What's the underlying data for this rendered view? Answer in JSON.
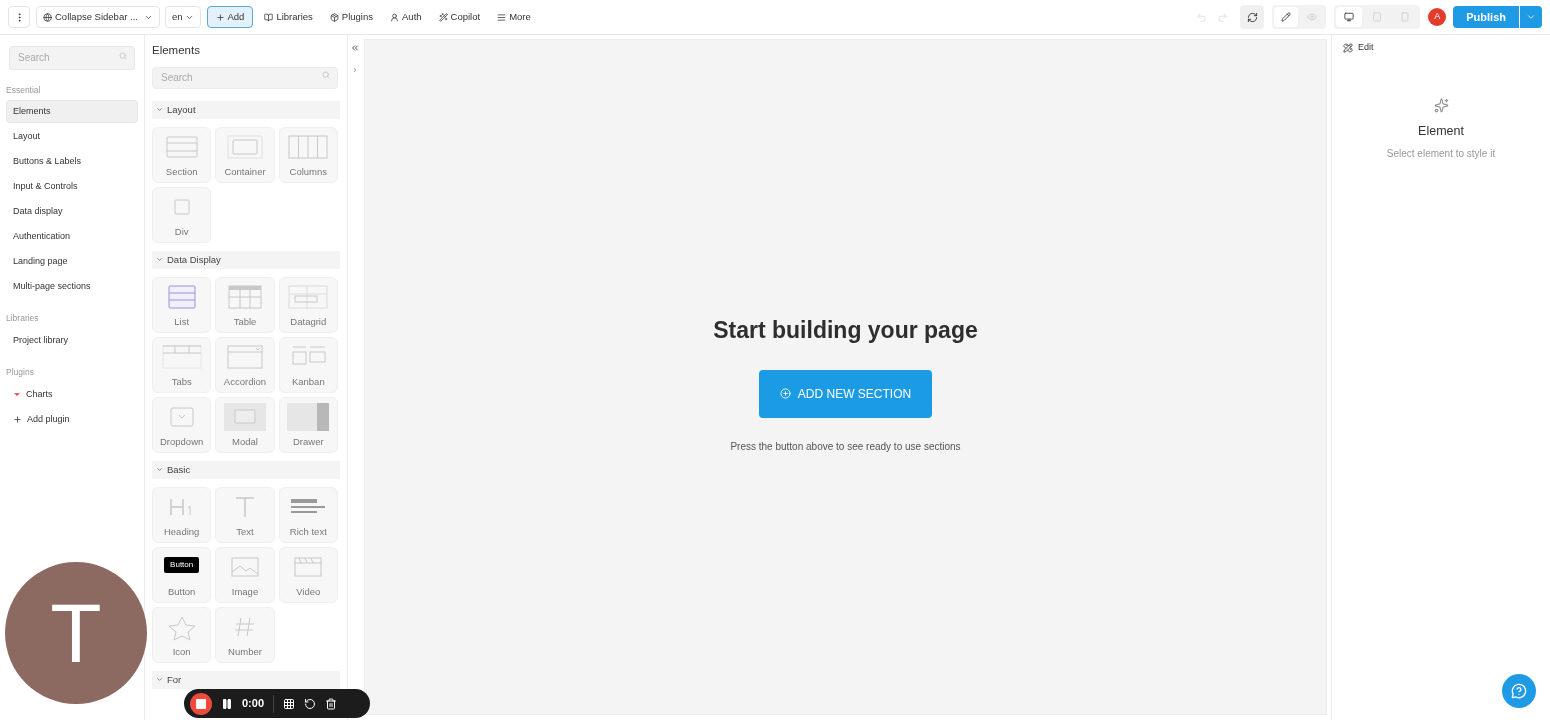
{
  "topbar": {
    "page_select": "Collapse Sidebar ...",
    "language": "en",
    "nav": [
      {
        "label": "Add",
        "kind": "add",
        "selected": true
      },
      {
        "label": "Libraries",
        "kind": "libraries",
        "selected": false
      },
      {
        "label": "Plugins",
        "kind": "plugins",
        "selected": false
      },
      {
        "label": "Auth",
        "kind": "auth",
        "selected": false
      },
      {
        "label": "Copilot",
        "kind": "copilot",
        "selected": false
      },
      {
        "label": "More",
        "kind": "more",
        "selected": false
      }
    ],
    "modes": [
      {
        "kind": "edit",
        "selected": true
      },
      {
        "kind": "preview",
        "selected": false
      }
    ],
    "devices": [
      {
        "kind": "desktop",
        "selected": true
      },
      {
        "kind": "tablet",
        "selected": false
      },
      {
        "kind": "phone",
        "selected": false
      }
    ],
    "avatar": "A",
    "publish": "Publish"
  },
  "sidebar": {
    "search_placeholder": "Search",
    "groups": [
      {
        "title": "Essential",
        "items": [
          {
            "label": "Elements",
            "kind": "page",
            "selected": true
          },
          {
            "label": "Layout",
            "kind": "page",
            "selected": false
          },
          {
            "label": "Buttons & Labels",
            "kind": "page",
            "selected": false
          },
          {
            "label": "Input & Controls",
            "kind": "page",
            "selected": false
          },
          {
            "label": "Data display",
            "kind": "page",
            "selected": false
          },
          {
            "label": "Authentication",
            "kind": "page",
            "selected": false
          },
          {
            "label": "Landing page",
            "kind": "page",
            "selected": false
          },
          {
            "label": "Multi-page sections",
            "kind": "page",
            "selected": false
          }
        ]
      },
      {
        "title": "Libraries",
        "items": [
          {
            "label": "Project library",
            "kind": "page",
            "selected": false
          }
        ]
      },
      {
        "title": "Plugins",
        "items": [
          {
            "label": "Charts",
            "kind": "plugin",
            "selected": false
          },
          {
            "label": "Add plugin",
            "kind": "add",
            "selected": false
          }
        ]
      }
    ]
  },
  "elements_panel": {
    "title": "Elements",
    "search_placeholder": "Search",
    "sections": [
      {
        "title": "Layout",
        "expanded": true,
        "tiles": [
          {
            "label": "Section",
            "kind": "section"
          },
          {
            "label": "Container",
            "kind": "container"
          },
          {
            "label": "Columns",
            "kind": "columns"
          },
          {
            "label": "Div",
            "kind": "div"
          }
        ]
      },
      {
        "title": "Data Display",
        "expanded": true,
        "tiles": [
          {
            "label": "List",
            "kind": "list"
          },
          {
            "label": "Table",
            "kind": "table"
          },
          {
            "label": "Datagrid",
            "kind": "datagrid"
          },
          {
            "label": "Tabs",
            "kind": "tabs"
          },
          {
            "label": "Accordion",
            "kind": "accordion"
          },
          {
            "label": "Kanban",
            "kind": "kanban"
          },
          {
            "label": "Dropdown",
            "kind": "dropdown"
          },
          {
            "label": "Modal",
            "kind": "modal"
          },
          {
            "label": "Drawer",
            "kind": "drawer"
          }
        ]
      },
      {
        "title": "Basic",
        "expanded": true,
        "tiles": [
          {
            "label": "Heading",
            "kind": "heading"
          },
          {
            "label": "Text",
            "kind": "text"
          },
          {
            "label": "Rich text",
            "kind": "richtext"
          },
          {
            "label": "Button",
            "kind": "button",
            "sample": "Button"
          },
          {
            "label": "Image",
            "kind": "image"
          },
          {
            "label": "Video",
            "kind": "video"
          },
          {
            "label": "Icon",
            "kind": "icon"
          },
          {
            "label": "Number",
            "kind": "number"
          }
        ]
      },
      {
        "title": "For",
        "expanded": true
      }
    ]
  },
  "canvas": {
    "heading": "Start building your page",
    "button": "ADD NEW SECTION",
    "hint": "Press the button above to see ready to use sections"
  },
  "inspector": {
    "tab": "Edit",
    "title": "Element",
    "subtitle": "Select element to style it"
  },
  "camera_bubble": {
    "letter": "T"
  },
  "recorder": {
    "time": "0:00"
  }
}
